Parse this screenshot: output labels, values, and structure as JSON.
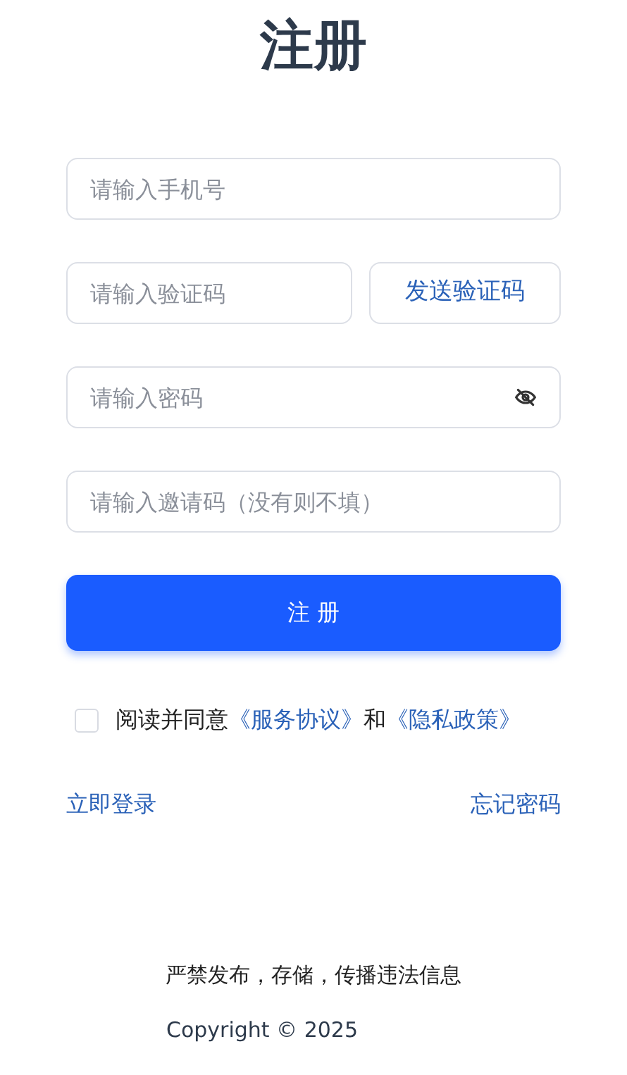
{
  "title": "注册",
  "fields": [
    {
      "kind": "text",
      "placeholder": "请输入手机号"
    },
    {
      "kind": "code",
      "placeholder": "请输入验证码",
      "button": "发送验证码"
    },
    {
      "kind": "password",
      "placeholder": "请输入密码"
    },
    {
      "kind": "text",
      "placeholder": "请输入邀请码（没有则不填）"
    }
  ],
  "submit": "注 册",
  "agreement": {
    "checked": false,
    "parts": [
      {
        "kind": "text",
        "text": "阅读并同意"
      },
      {
        "kind": "link",
        "text": "《服务协议》"
      },
      {
        "kind": "text",
        "text": "和"
      },
      {
        "kind": "link",
        "text": "《隐私政策》"
      }
    ]
  },
  "links": [
    "立即登录",
    "忘记密码"
  ],
  "footer": {
    "notice": "严禁发布，存储，传播违法信息",
    "copyright": "Copyright © 2025"
  }
}
